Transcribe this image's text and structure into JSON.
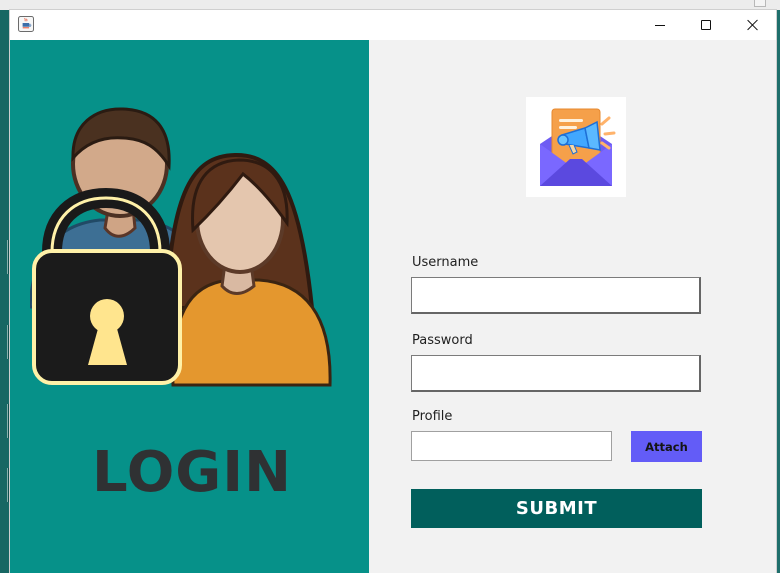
{
  "window": {
    "app_icon": "java-app-icon",
    "controls": {
      "minimize_icon": "minimize-icon",
      "maximize_icon": "maximize-icon",
      "close_icon": "close-icon"
    }
  },
  "left_panel": {
    "illustration": "users-with-padlock-illustration",
    "heading": "LOGIN",
    "background_color": "#069189",
    "heading_color": "#2f3133"
  },
  "right_panel": {
    "logo": "email-megaphone-logo",
    "fields": {
      "username_label": "Username",
      "username_value": "",
      "password_label": "Password",
      "password_value": "",
      "profile_label": "Profile",
      "profile_value": ""
    },
    "buttons": {
      "attach_label": "Attach",
      "submit_label": "SUBMIT"
    },
    "colors": {
      "attach": "#635cf7",
      "submit": "#015f5c"
    }
  }
}
